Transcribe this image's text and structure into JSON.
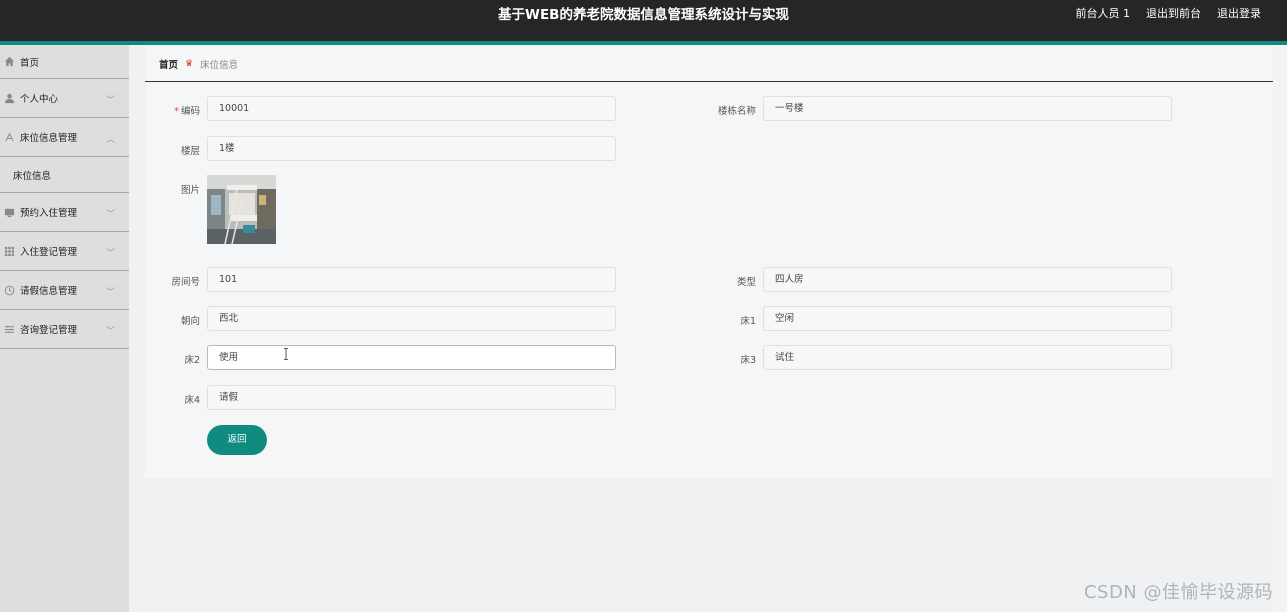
{
  "header": {
    "title": "基于WEB的养老院数据信息管理系统设计与实现",
    "user": "前台人员 1",
    "exit_front": "退出到前台",
    "logout": "退出登录"
  },
  "sidebar": {
    "items": [
      {
        "label": "首页",
        "icon": "home-icon"
      },
      {
        "label": "个人中心",
        "icon": "user-icon"
      },
      {
        "label": "床位信息管理",
        "icon": "bed-icon"
      },
      {
        "label": "床位信息",
        "icon": ""
      },
      {
        "label": "预约入住管理",
        "icon": "monitor-icon"
      },
      {
        "label": "入住登记管理",
        "icon": "grid-icon"
      },
      {
        "label": "请假信息管理",
        "icon": "clock-icon"
      },
      {
        "label": "咨询登记管理",
        "icon": "list-icon"
      }
    ]
  },
  "breadcrumb": {
    "home": "首页",
    "current": "床位信息"
  },
  "form": {
    "code_label": "编码",
    "code_value": "10001",
    "building_label": "楼栋名称",
    "building_value": "一号楼",
    "floor_label": "楼层",
    "floor_value": "1楼",
    "image_label": "图片",
    "room_label": "房间号",
    "room_value": "101",
    "type_label": "类型",
    "type_value": "四人房",
    "orient_label": "朝向",
    "orient_value": "西北",
    "bed1_label": "床1",
    "bed1_value": "空闲",
    "bed2_label": "床2",
    "bed2_value": "使用",
    "bed3_label": "床3",
    "bed3_value": "试住",
    "bed4_label": "床4",
    "bed4_value": "请假",
    "back_button": "返回"
  },
  "watermark": "CSDN @佳愉毕设源码",
  "colors": {
    "accent": "#0f8b80",
    "header": "#262626",
    "sidebar": "#dedede"
  }
}
